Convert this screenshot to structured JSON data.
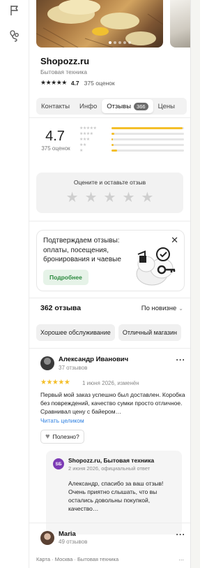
{
  "company": {
    "name": "Shopozz.ru",
    "category": "Бытовая техника",
    "rating": "4.7",
    "stars": "★★★★★",
    "reviews_count_label": "375 оценок"
  },
  "photos": {
    "count": 5,
    "active_index": 0
  },
  "tabs": [
    {
      "label": "Контакты",
      "active": false
    },
    {
      "label": "Инфо",
      "active": false
    },
    {
      "label": "Отзывы",
      "active": true,
      "badge": "366"
    },
    {
      "label": "Цены",
      "active": false
    }
  ],
  "rating_summary": {
    "value": "4.7",
    "count_label": "375 оценок",
    "distribution": [
      {
        "stars": "★★★★★",
        "fraction": 0.98
      },
      {
        "stars": "★★★★",
        "fraction": 0.04
      },
      {
        "stars": "★★★",
        "fraction": 0.02
      },
      {
        "stars": "★★",
        "fraction": 0.03
      },
      {
        "stars": "★",
        "fraction": 0.08
      }
    ]
  },
  "rate_prompt": {
    "title": "Оцените и оставьте отзыв",
    "stars": [
      "★",
      "★",
      "★",
      "★",
      "★"
    ]
  },
  "promo": {
    "text": "Подтверждаем отзывы: оплаты, посещения, бронирования и чаевые",
    "button": "Подробнее",
    "close": "✕"
  },
  "reviews_header": {
    "count": "362 отзыва",
    "sort": "По новизне",
    "sort_chevron": "⌄"
  },
  "chips": [
    "Хорошее обслуживание",
    "Отличный магазин"
  ],
  "reviews": [
    {
      "author": "Александр Иванович",
      "author_meta": "37 отзывов",
      "stars": "★★★★★",
      "date": "1 июня 2026, изменён",
      "text": "Первый мой заказ успешно был доставлен. Коробка без повреждений, качество сумки просто отличное. Сравнивал цену с байером…",
      "read_more": "Читать целиком",
      "useful": "Полезно?",
      "answer": {
        "logo": "SБ",
        "name": "Shopozz.ru, Бытовая техника",
        "meta": "2 июня 2026, официальный ответ",
        "text": "Александр, спасибо за ваш отзыв! Очень приятно слышать, что вы остались довольны покупкой, качество…"
      }
    },
    {
      "author": "Maria",
      "author_meta": "49 отзывов"
    }
  ],
  "footer": {
    "breadcrumbs": "Карта · Москва · Бытовая техника",
    "more": "..."
  },
  "colors": {
    "star_yellow": "#f4bf2a",
    "link_blue": "#2d7fe0",
    "promo_green": "#2b8a3e",
    "answer_logo": "#7c3bb5"
  }
}
